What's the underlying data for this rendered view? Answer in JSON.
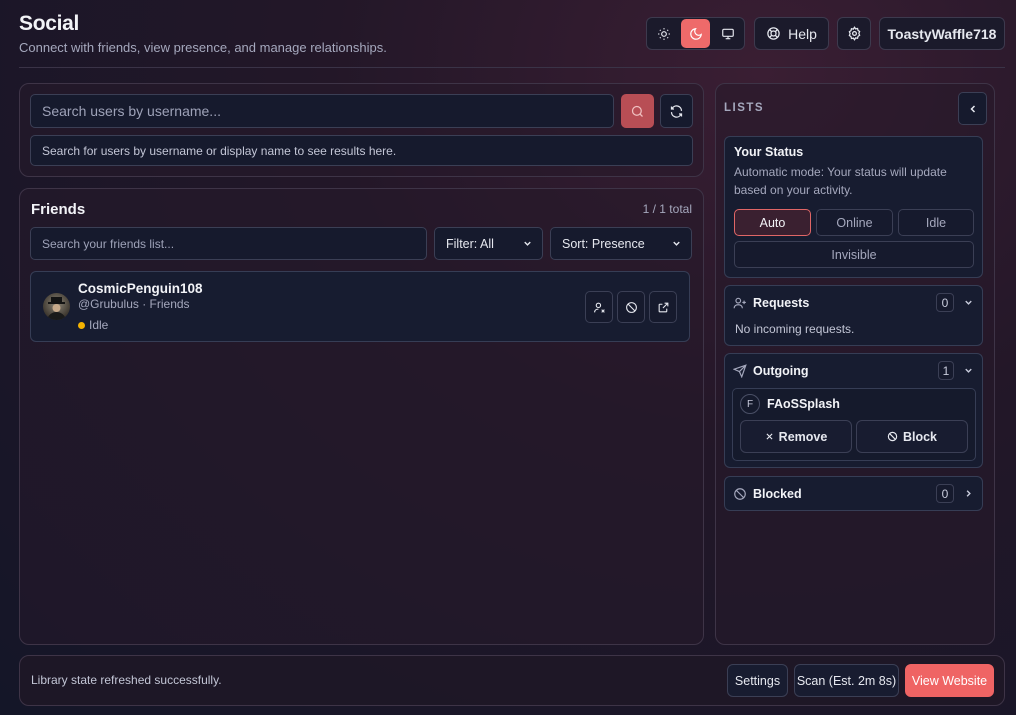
{
  "header": {
    "title": "Social",
    "subtitle": "Connect with friends, view presence, and manage relationships.",
    "help_label": "Help",
    "username": "ToastyWaffle718"
  },
  "search": {
    "placeholder": "Search users by username...",
    "hint": "Search for users by username or display name to see results here."
  },
  "friends": {
    "title": "Friends",
    "count": "1 / 1 total",
    "filter_placeholder": "Search your friends list...",
    "filter_label": "Filter: All",
    "sort_label": "Sort: Presence",
    "items": [
      {
        "display_name": "CosmicPenguin108",
        "meta": "@Grubulus · Friends",
        "presence": "Idle",
        "presence_color": "#f5b301"
      }
    ]
  },
  "lists": {
    "title": "LISTS",
    "status": {
      "title": "Your Status",
      "description": "Automatic mode: Your status will update based on your activity.",
      "options": [
        "Auto",
        "Online",
        "Idle",
        "Invisible"
      ],
      "selected": "Auto"
    },
    "requests": {
      "title": "Requests",
      "count": "0",
      "empty": "No incoming requests."
    },
    "outgoing": {
      "title": "Outgoing",
      "count": "1",
      "items": [
        {
          "initial": "F",
          "name": "FAoSSplash",
          "remove_label": "Remove",
          "block_label": "Block"
        }
      ]
    },
    "blocked": {
      "title": "Blocked",
      "count": "0"
    }
  },
  "footer": {
    "status": "Library state refreshed successfully.",
    "settings_label": "Settings",
    "scan_label": "Scan (Est. 2m 8s)",
    "website_label": "View Website"
  },
  "colors": {
    "accent": "#ef6464",
    "idle": "#f5b301"
  }
}
